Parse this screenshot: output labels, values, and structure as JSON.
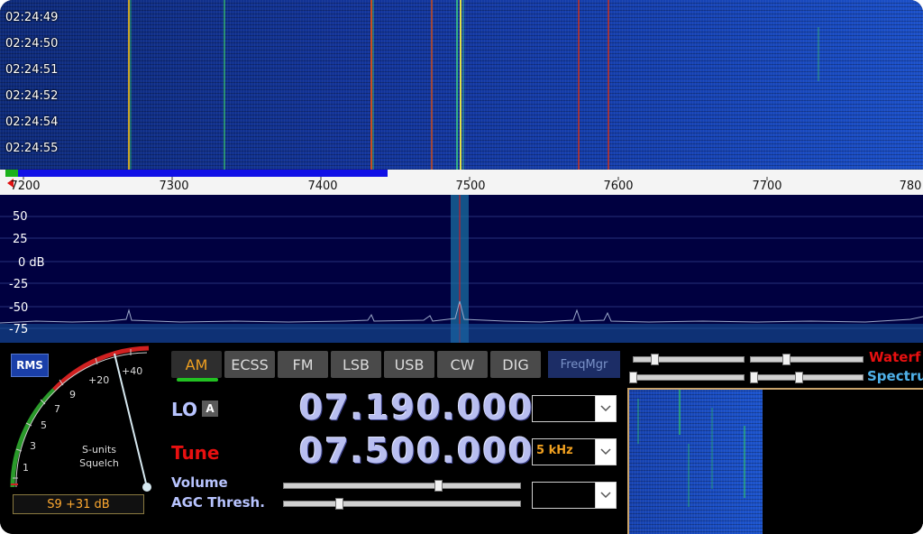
{
  "waterfall": {
    "times": [
      "02:24:49",
      "02:24:50",
      "02:24:51",
      "02:24:52",
      "02:24:54",
      "02:24:55"
    ]
  },
  "freq_axis": {
    "ticks": [
      "7200",
      "7300",
      "7400",
      "7500",
      "7600",
      "7700",
      "780"
    ]
  },
  "spectrum": {
    "db_labels": [
      "50",
      "25",
      "0 dB",
      "-25",
      "-50",
      "-75"
    ]
  },
  "meter": {
    "rms_label": "RMS",
    "scale_labels": [
      "1",
      "3",
      "5",
      "7",
      "9",
      "+20",
      "+40"
    ],
    "caption_line1": "S-units",
    "caption_line2": "Squelch",
    "readout": "S9 +31 dB"
  },
  "modes": {
    "buttons": [
      "AM",
      "ECSS",
      "FM",
      "LSB",
      "USB",
      "CW",
      "DIG"
    ],
    "active": "AM",
    "freqmgr_label": "FreqMgr"
  },
  "tuning": {
    "lo_label": "LO",
    "lo_badge": "A",
    "lo_frequency": "07.190.000",
    "tune_label": "Tune",
    "tune_frequency": "07.500.000",
    "step_value": "5 kHz",
    "volume_label": "Volume",
    "agc_label": "AGC Thresh.",
    "volume_level": 0.6,
    "agc_level": 0.23
  },
  "display_controls": {
    "waterfall_label": "Waterf",
    "spectrum_label": "Spectru"
  },
  "colors": {
    "tune_red": "#e81010",
    "accent_orange": "#f0a020",
    "lo_blue": "#b8c4ff",
    "spectrum_bg": "#000040"
  }
}
